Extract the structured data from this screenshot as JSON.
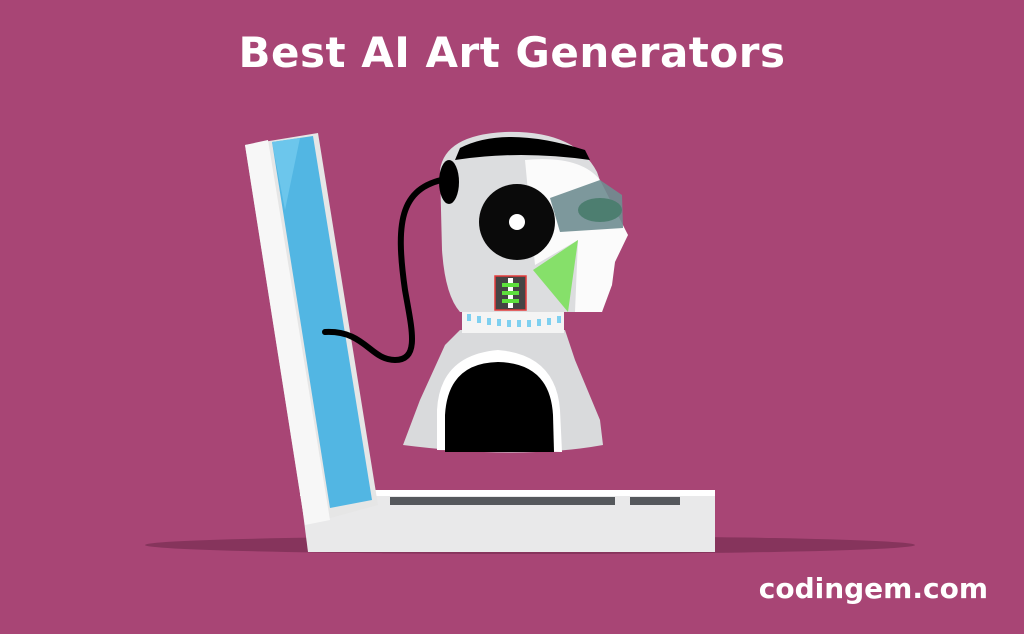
{
  "header": {
    "title": "Best AI Art Generators"
  },
  "footer": {
    "site": "codingem.com"
  },
  "illustration": {
    "subject": "robot-head-connected-to-laptop"
  },
  "colors": {
    "background": "#a84575",
    "screen": "#52b6e3",
    "accent_green": "#86e06a",
    "text": "#ffffff"
  }
}
